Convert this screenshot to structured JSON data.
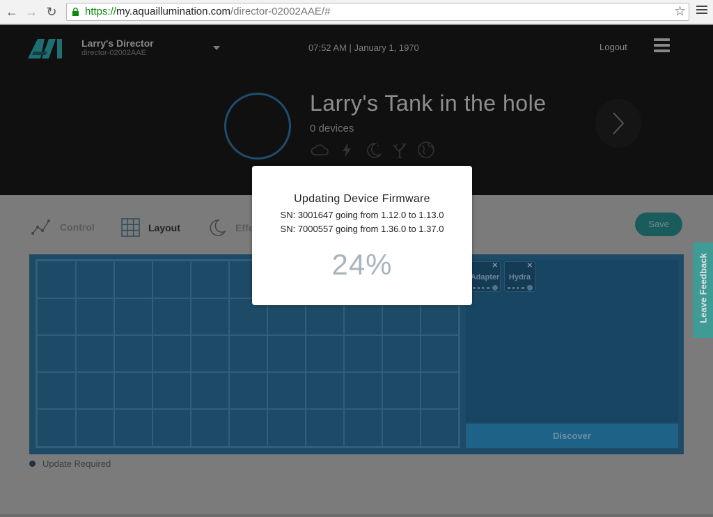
{
  "browser": {
    "url_scheme": "https://",
    "url_host": "my.aquaillumination.com",
    "url_path": "/director-02002AAE/#"
  },
  "header": {
    "tank_name": "Larry's Director",
    "tank_id": "director-02002AAE",
    "datetime": "07:52 AM |  January 1, 1970",
    "logout_label": "Logout"
  },
  "hero": {
    "title": "Larry's Tank in the hole",
    "devices": "0 devices",
    "icons": [
      "cloud-icon",
      "lightning-icon",
      "moon-icon",
      "coral-icon",
      "globe-icon"
    ]
  },
  "tabs": [
    {
      "label": "Control",
      "icon": "chart-line-icon"
    },
    {
      "label": "Layout",
      "icon": "grid-icon"
    },
    {
      "label": "Effe",
      "icon": "moon-effects-icon"
    }
  ],
  "save_label": "Save",
  "devices": [
    {
      "name": "Adapter"
    },
    {
      "name": "Hydra"
    }
  ],
  "discover_label": "Discover",
  "legend_label": "Update Required",
  "feedback_label": "Leave Feedback",
  "modal": {
    "title": "Updating Device Firmware",
    "lines": [
      "SN: 3001647 going from 1.12.0 to 1.13.0",
      "SN: 7000557 going from 1.36.0 to 1.37.0"
    ],
    "percent": "24%",
    "progress": 0.24
  },
  "colors": {
    "accent": "#1e6287",
    "save": "#1a5b5c",
    "feedback": "#2aa6a0"
  }
}
